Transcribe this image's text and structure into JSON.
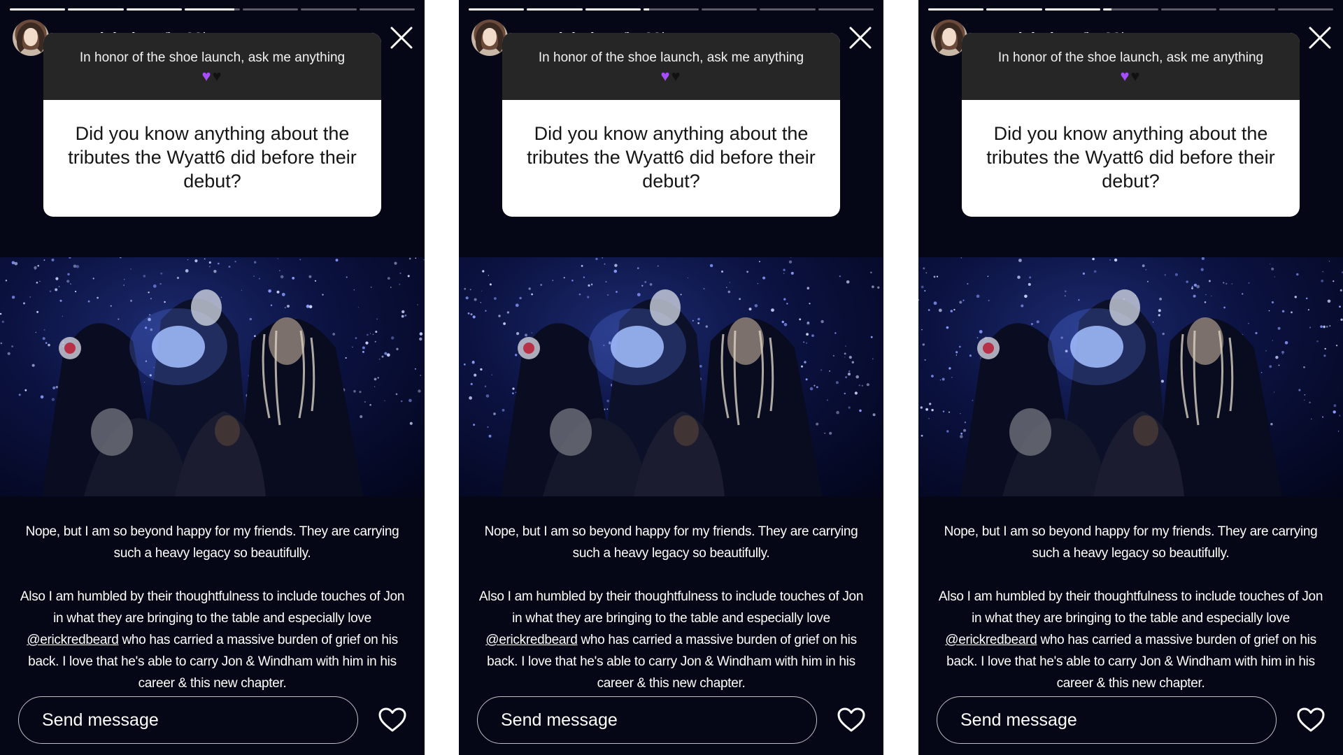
{
  "stories": [
    {
      "progress_fill": [
        1,
        1,
        1,
        0.9,
        0,
        0,
        0
      ],
      "header": {
        "username": "mandahuber",
        "timestamp": "22h"
      },
      "question": {
        "prompt": "In honor of the shoe launch, ask me anything",
        "emojis": [
          "purple-heart",
          "black-heart"
        ],
        "text": "Did you know anything about the tributes the Wyatt6 did before their debut?"
      },
      "caption": {
        "paragraph1": "Nope, but I am so beyond happy for my friends. They are carrying such a heavy legacy so beautifully.",
        "paragraph2_before": "Also I am humbled by their thoughtfulness to include touches of Jon in what they are bringing to the table and especially love ",
        "mention": "@erickredbeard",
        "paragraph2_after": " who has carried a massive burden of grief on his back. I love that he's able to carry Jon & Windham with him in his career & this new chapter."
      },
      "footer": {
        "send_placeholder": "Send message"
      }
    },
    {
      "progress_fill": [
        1,
        1,
        1,
        0.1,
        0,
        0,
        0
      ],
      "header": {
        "username": "mandahuber",
        "timestamp": "22h"
      },
      "question": {
        "prompt": "In honor of the shoe launch, ask me anything",
        "emojis": [
          "purple-heart",
          "black-heart"
        ],
        "text": "Did you know anything about the tributes the Wyatt6 did before their debut?"
      },
      "caption": {
        "paragraph1": "Nope, but I am so beyond happy for my friends. They are carrying such a heavy legacy so beautifully.",
        "paragraph2_before": "Also I am humbled by their thoughtfulness to include touches of Jon in what they are bringing to the table and especially love ",
        "mention": "@erickredbeard",
        "paragraph2_after": " who has carried a massive burden of grief on his back. I love that he's able to carry Jon & Windham with him in his career & this new chapter."
      },
      "footer": {
        "send_placeholder": "Send message"
      }
    },
    {
      "progress_fill": [
        1,
        1,
        1,
        0.15,
        0,
        0,
        0
      ],
      "header": {
        "username": "mandahuber",
        "timestamp": "22h"
      },
      "question": {
        "prompt": "In honor of the shoe launch, ask me anything",
        "emojis": [
          "purple-heart",
          "black-heart"
        ],
        "text": "Did you know anything about the tributes the Wyatt6 did before their debut?"
      },
      "caption": {
        "paragraph1": "Nope, but I am so beyond happy for my friends. They are carrying such a heavy legacy so beautifully.",
        "paragraph2_before": "Also I am humbled by their thoughtfulness to include touches of Jon in what they are bringing to the table and especially love ",
        "mention": "@erickredbeard",
        "paragraph2_after": " who has carried a massive burden of grief on his back. I love that he's able to carry Jon & Windham with him in his career & this new chapter."
      },
      "footer": {
        "send_placeholder": "Send message"
      }
    }
  ],
  "colors": {
    "story_background": "#050716",
    "question_header": "#262626",
    "heart_purple": "#a64dff"
  }
}
